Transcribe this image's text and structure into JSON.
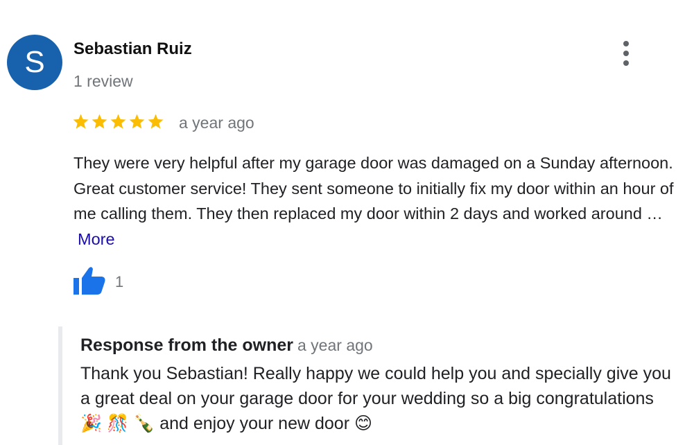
{
  "reviewer": {
    "avatar_letter": "S",
    "name": "Sebastian Ruiz",
    "review_count": "1 review"
  },
  "review": {
    "rating": 5,
    "max_rating": 5,
    "date": "a year ago",
    "text": "They were very helpful after my garage door was damaged on a Sunday afternoon. Great customer service! They sent someone to initially fix my door within an hour of me calling them. They then replaced my door within 2 days and worked around …",
    "more_label": "More",
    "likes": "1"
  },
  "owner_response": {
    "title": "Response from the owner",
    "date": "a year ago",
    "text": "Thank you Sebastian! Really happy we could help you and specially give you a great deal on your garage door for your wedding so a big congratulations 🎉 🎊 🍾 and enjoy your new door 😊"
  },
  "colors": {
    "avatar_bg": "#1761ad",
    "star": "#fbbc04",
    "link": "#1a0dab",
    "like_icon": "#1a73e8",
    "secondary_text": "#70757a"
  },
  "icons": {
    "menu": "more-vert-icon",
    "star": "star-icon",
    "like": "thumbs-up-icon"
  }
}
